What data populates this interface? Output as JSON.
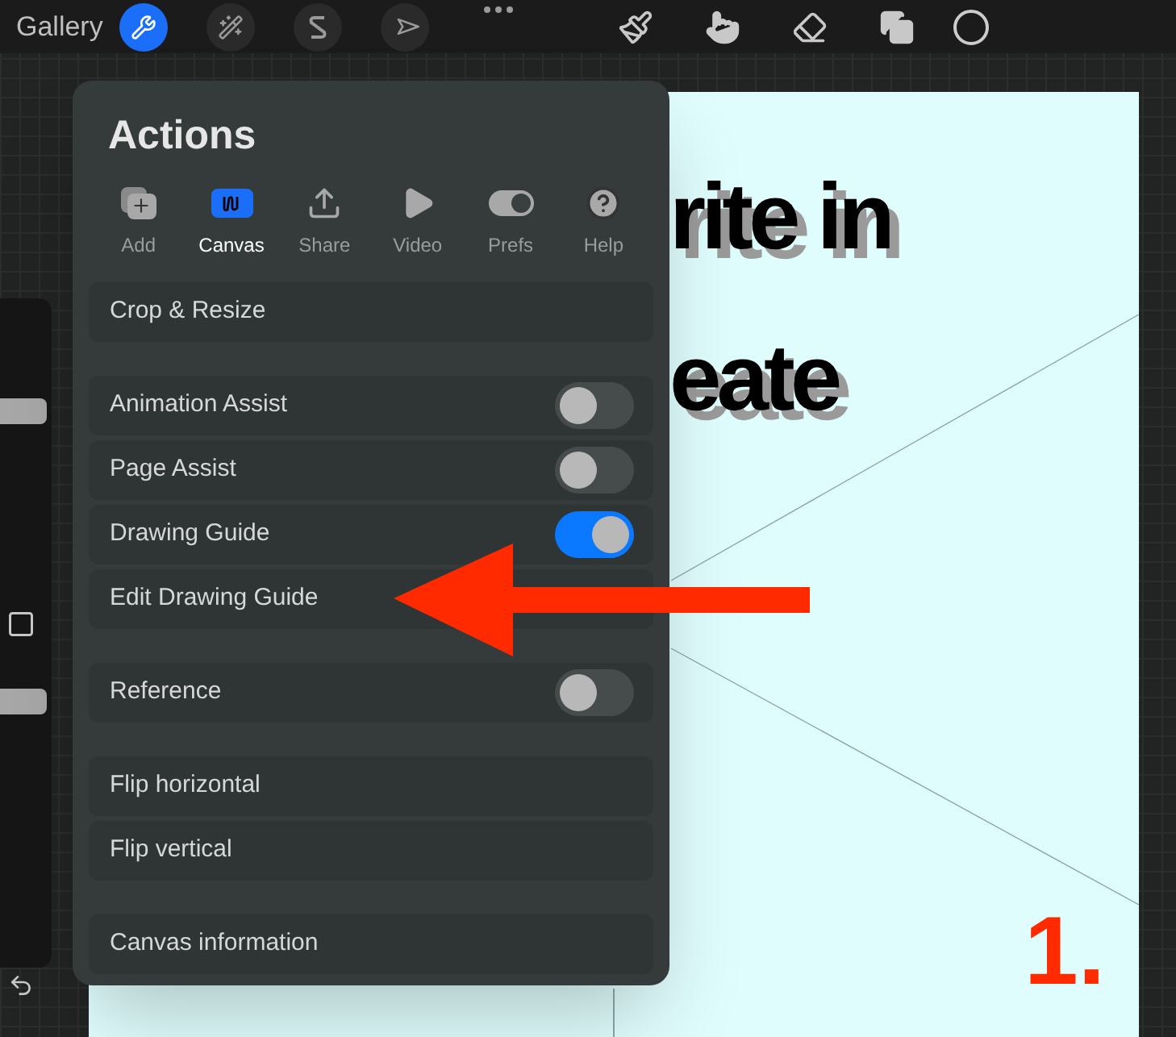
{
  "top_bar": {
    "gallery": "Gallery",
    "tools": [
      {
        "kind": "wrench",
        "selected": true
      },
      {
        "kind": "wand",
        "selected": false
      },
      {
        "kind": "selection",
        "selected": false
      },
      {
        "kind": "move",
        "selected": false
      }
    ]
  },
  "canvas": {
    "headline_lines": [
      "rite in",
      "eate"
    ],
    "number": "1."
  },
  "actions_panel": {
    "title": "Actions",
    "tabs": [
      {
        "label": "Add",
        "kind": "add",
        "selected": false
      },
      {
        "label": "Canvas",
        "kind": "canvas",
        "selected": true
      },
      {
        "label": "Share",
        "kind": "share",
        "selected": false
      },
      {
        "label": "Video",
        "kind": "video",
        "selected": false
      },
      {
        "label": "Prefs",
        "kind": "prefs",
        "selected": false
      },
      {
        "label": "Help",
        "kind": "help",
        "selected": false
      }
    ],
    "groups": [
      [
        {
          "label": "Crop & Resize",
          "kind": "action"
        }
      ],
      [
        {
          "label": "Animation Assist",
          "kind": "toggle",
          "on": false
        },
        {
          "label": "Page Assist",
          "kind": "toggle",
          "on": false
        },
        {
          "label": "Drawing Guide",
          "kind": "toggle",
          "on": true
        },
        {
          "label": "Edit Drawing Guide",
          "kind": "action"
        }
      ],
      [
        {
          "label": "Reference",
          "kind": "toggle",
          "on": false
        }
      ],
      [
        {
          "label": "Flip horizontal",
          "kind": "action"
        },
        {
          "label": "Flip vertical",
          "kind": "action"
        }
      ],
      [
        {
          "label": "Canvas information",
          "kind": "action"
        }
      ]
    ]
  }
}
